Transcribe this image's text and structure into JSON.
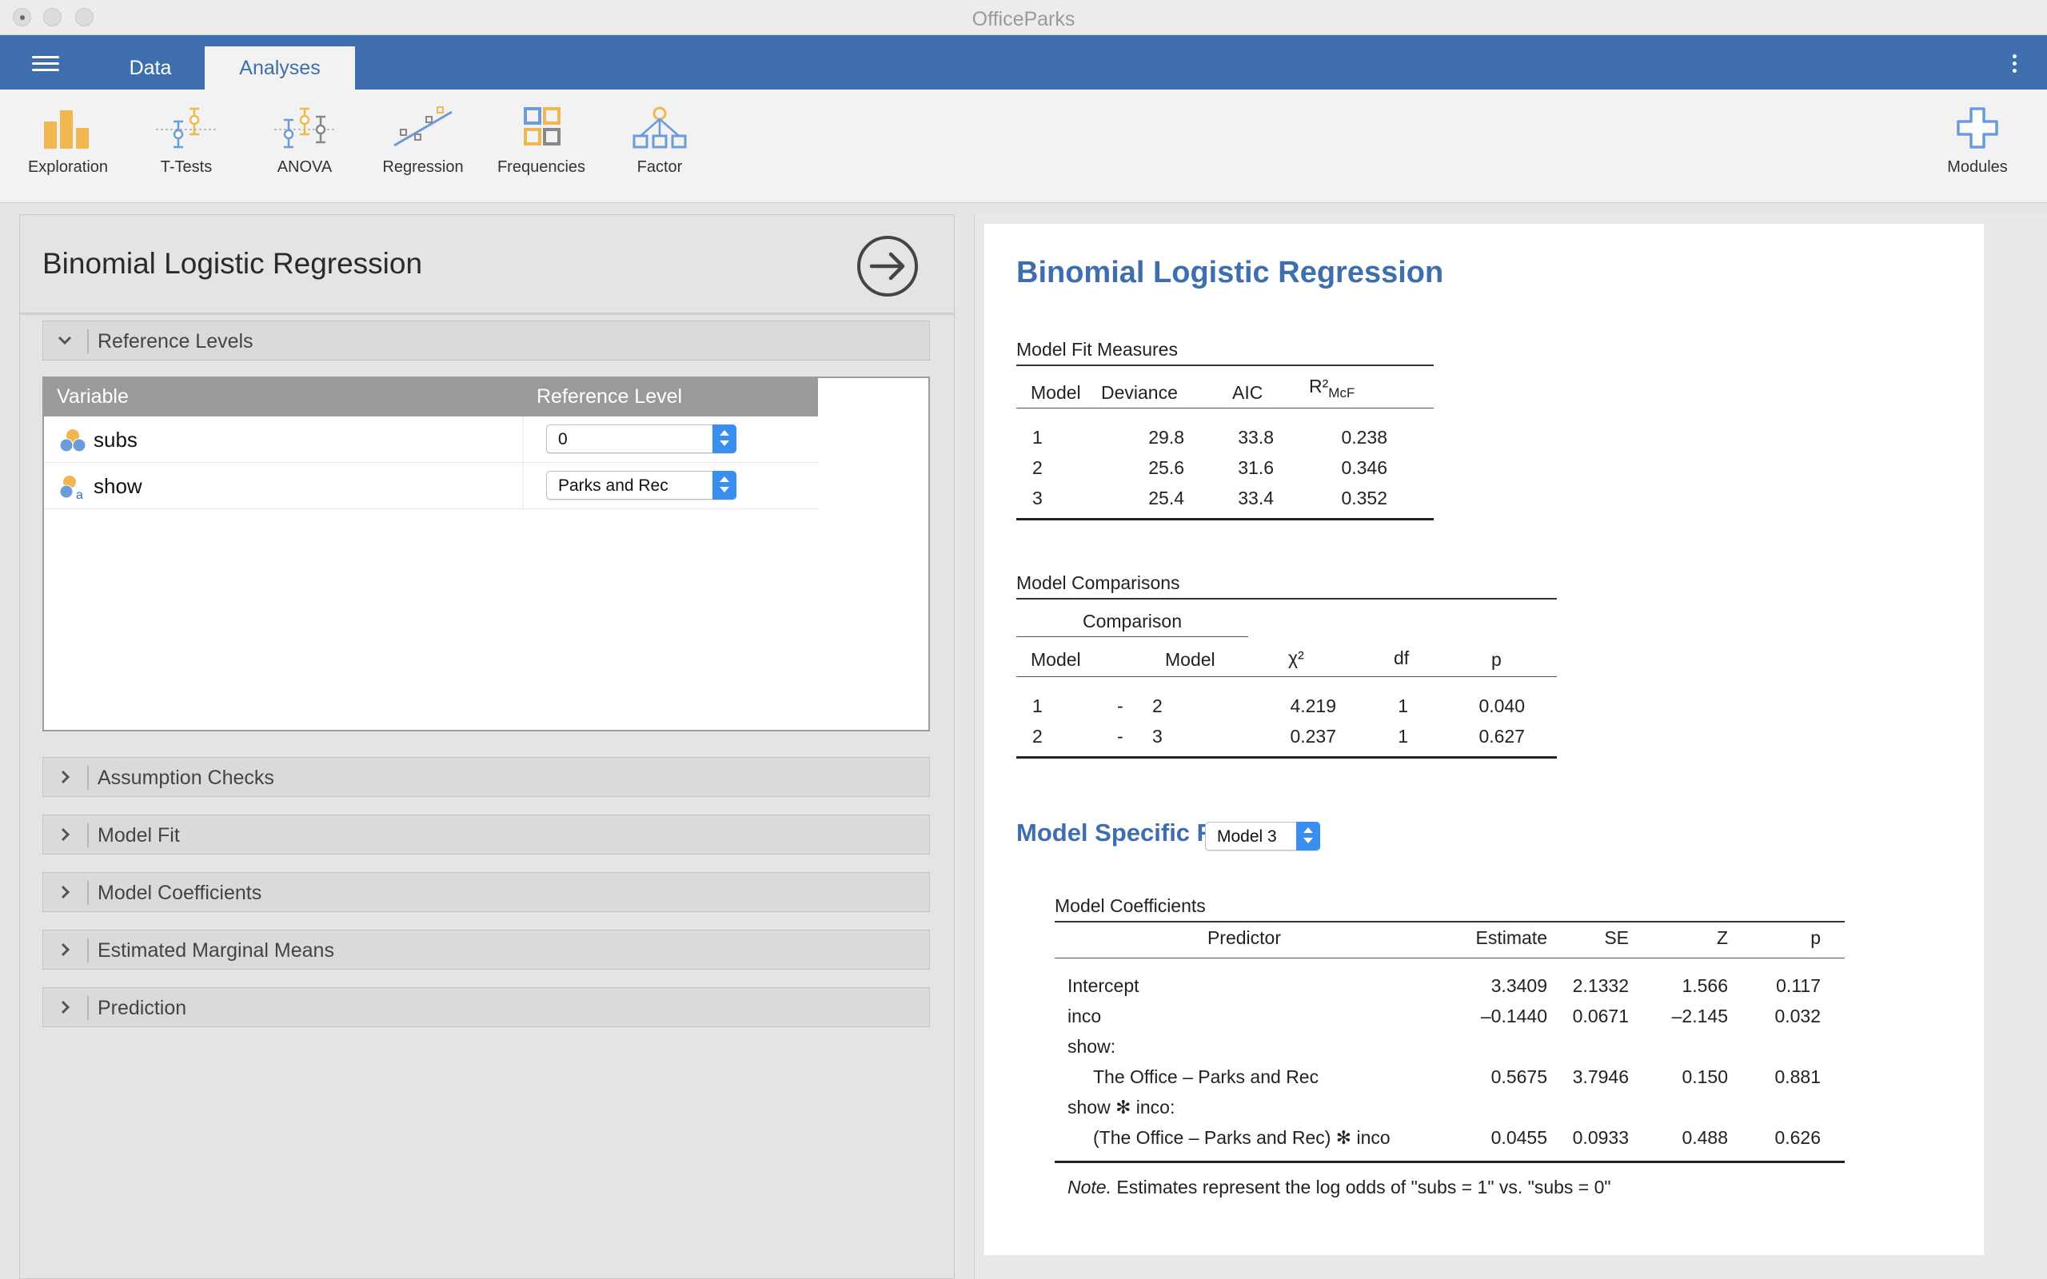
{
  "window": {
    "title": "OfficeParks"
  },
  "tabbar": {
    "tabs": [
      "Data",
      "Analyses"
    ]
  },
  "ribbon": {
    "buttons": [
      "Exploration",
      "T-Tests",
      "ANOVA",
      "Regression",
      "Frequencies",
      "Factor"
    ],
    "modules": "Modules"
  },
  "colors": {
    "accent": "#3e6ead",
    "ribbon_orange": "#f0b64f",
    "ribbon_blue": "#6b9bd9",
    "combo_blue": "#3a8ef0"
  },
  "options": {
    "title": "Binomial Logistic Regression",
    "reference_levels": {
      "section_label": "Reference Levels",
      "col_variable": "Variable",
      "col_level": "Reference Level",
      "rows": [
        {
          "variable": "subs",
          "level": "0",
          "icon": "nominal-variable-icon"
        },
        {
          "variable": "show",
          "level": "Parks and Rec",
          "icon": "nominal-text-variable-icon"
        }
      ]
    },
    "sections": [
      "Assumption Checks",
      "Model Fit",
      "Model Coefficients",
      "Estimated Marginal Means",
      "Prediction"
    ]
  },
  "results": {
    "title": "Binomial Logistic Regression",
    "model_fit": {
      "title": "Model Fit Measures",
      "headers": [
        "Model",
        "Deviance",
        "AIC",
        "R²",
        "McF"
      ],
      "rows": [
        [
          "1",
          "29.8",
          "33.8",
          "0.238"
        ],
        [
          "2",
          "25.6",
          "31.6",
          "0.346"
        ],
        [
          "3",
          "25.4",
          "33.4",
          "0.352"
        ]
      ]
    },
    "model_comparisons": {
      "title": "Model Comparisons",
      "group_header": "Comparison",
      "headers": [
        "Model",
        "Model",
        "χ²",
        "df",
        "p"
      ],
      "rows": [
        [
          "1",
          "-",
          "2",
          "4.219",
          "1",
          "0.040"
        ],
        [
          "2",
          "-",
          "3",
          "0.237",
          "1",
          "0.627"
        ]
      ]
    },
    "model_specific": {
      "title": "Model Specific Results",
      "selected_model": "Model 3",
      "coefficients": {
        "title": "Model Coefficients",
        "headers": [
          "Predictor",
          "Estimate",
          "SE",
          "Z",
          "p"
        ],
        "rows": [
          [
            "Intercept",
            "3.3409",
            "2.1332",
            "1.566",
            "0.117"
          ],
          [
            "inco",
            "–0.1440",
            "0.0671",
            "–2.145",
            "0.032"
          ],
          [
            "show:",
            "",
            "",
            "",
            ""
          ],
          [
            "The Office – Parks and Rec",
            "0.5675",
            "3.7946",
            "0.150",
            "0.881"
          ],
          [
            "show ✻ inco:",
            "",
            "",
            "",
            ""
          ],
          [
            "(The Office – Parks and Rec) ✻ inco",
            "0.0455",
            "0.0933",
            "0.488",
            "0.626"
          ]
        ],
        "note_label": "Note.",
        "note_text": "Estimates represent the log odds of \"subs = 1\" vs. \"subs = 0\""
      }
    }
  }
}
